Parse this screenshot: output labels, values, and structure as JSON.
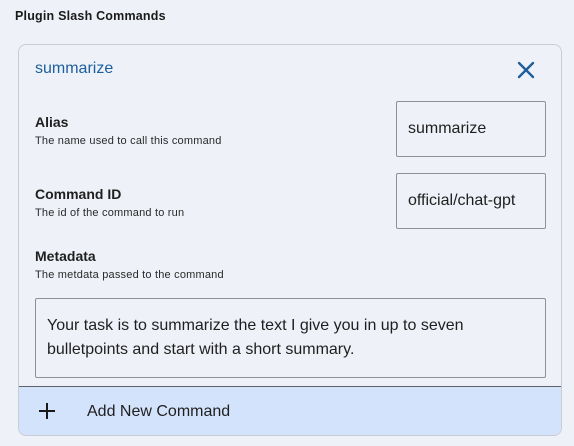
{
  "section": {
    "title": "Plugin Slash Commands"
  },
  "command": {
    "title": "summarize",
    "alias": {
      "label": "Alias",
      "description": "The name used to call this command",
      "value": "summarize"
    },
    "command_id": {
      "label": "Command ID",
      "description": "The id of the command to run",
      "value": "official/chat-gpt"
    },
    "metadata": {
      "label": "Metadata",
      "description": "The metdata passed to the command",
      "value": "Your task is to summarize the text I give you in up to seven bulletpoints and start with a short summary."
    }
  },
  "add_command": {
    "label": "Add New Command"
  },
  "colors": {
    "accent": "#1d5f9c",
    "add_row_background": "#d3e3fb",
    "card_background": "#eef1f8"
  }
}
